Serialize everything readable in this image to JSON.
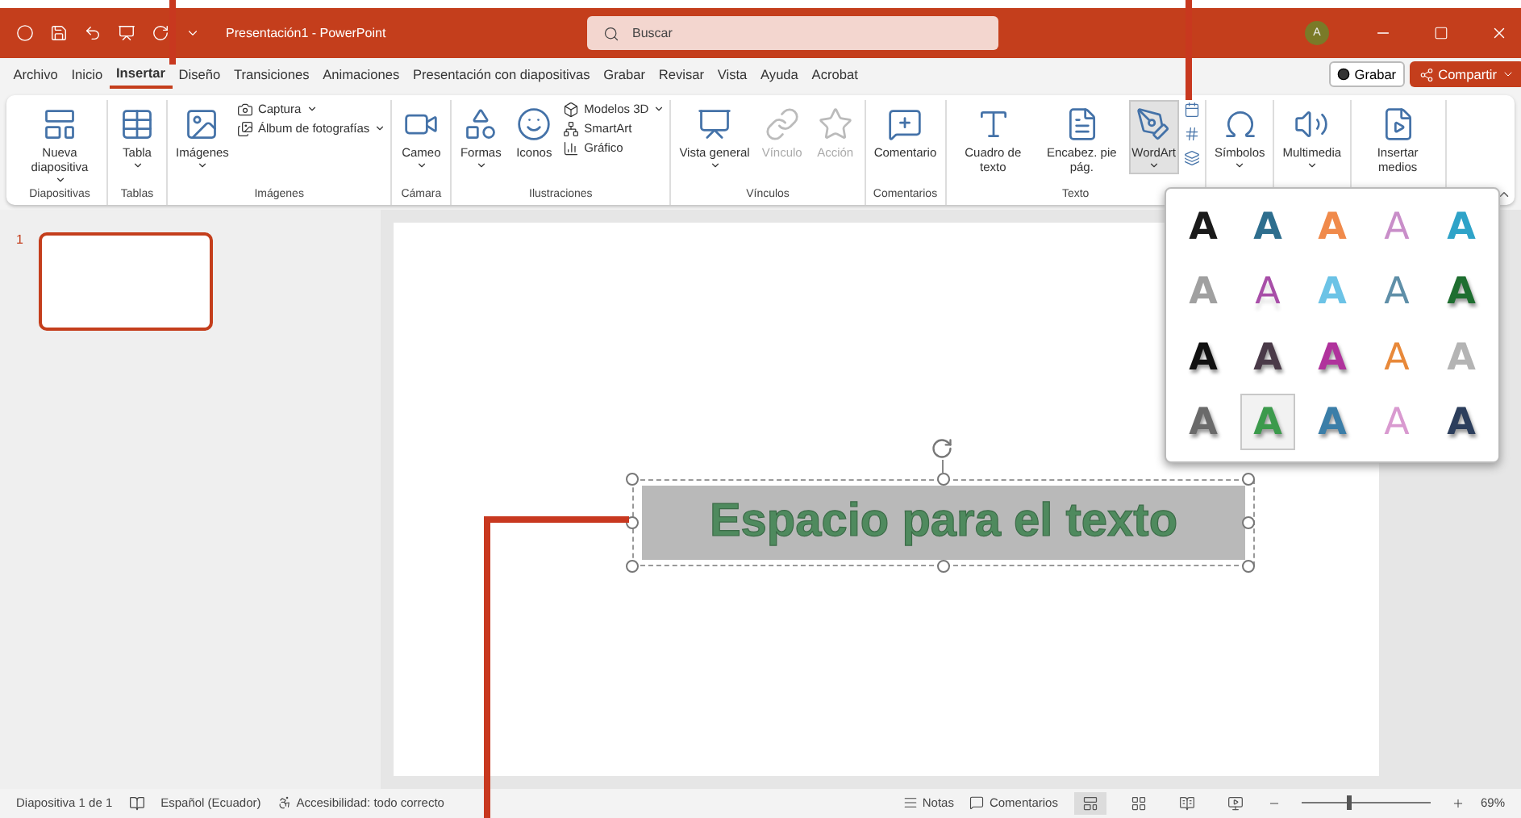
{
  "title_bar": {
    "title": "Presentación1 - PowerPoint",
    "search": {
      "placeholder": "Buscar"
    },
    "avatar": "A"
  },
  "tabs": [
    {
      "label": "Archivo",
      "selected": false
    },
    {
      "label": "Inicio",
      "selected": false
    },
    {
      "label": "Insertar",
      "selected": true
    },
    {
      "label": "Diseño",
      "selected": false
    },
    {
      "label": "Transiciones",
      "selected": false
    },
    {
      "label": "Animaciones",
      "selected": false
    },
    {
      "label": "Presentación con diapositivas",
      "selected": false
    },
    {
      "label": "Grabar",
      "selected": false
    },
    {
      "label": "Revisar",
      "selected": false
    },
    {
      "label": "Vista",
      "selected": false
    },
    {
      "label": "Ayuda",
      "selected": false
    },
    {
      "label": "Acrobat",
      "selected": false
    }
  ],
  "record_button": "Grabar",
  "share_button": "Compartir",
  "ribbon": [
    {
      "label": "Diapositivas",
      "items": [
        {
          "kind": "large",
          "label": "Nueva diapositiva",
          "dropdown": true
        }
      ]
    },
    {
      "label": "Tablas",
      "items": [
        {
          "kind": "large",
          "label": "Tabla",
          "dropdown": true
        }
      ]
    },
    {
      "label": "Imágenes",
      "items": [
        {
          "kind": "large",
          "label": "Imágenes",
          "dropdown": true
        },
        {
          "kind": "stack",
          "items": [
            {
              "label": "Captura",
              "dropdown": true
            },
            {
              "label": "Álbum de fotografías",
              "dropdown": true
            }
          ]
        }
      ]
    },
    {
      "label": "Cámara",
      "items": [
        {
          "kind": "large",
          "label": "Cameo",
          "dropdown": true
        }
      ]
    },
    {
      "label": "Ilustraciones",
      "items": [
        {
          "kind": "large",
          "label": "Formas",
          "dropdown": true
        },
        {
          "kind": "large",
          "label": "Iconos",
          "dropdown": false
        },
        {
          "kind": "stack",
          "items": [
            {
              "label": "Modelos 3D",
              "dropdown": true
            },
            {
              "label": "SmartArt",
              "dropdown": false
            },
            {
              "label": "Gráfico",
              "dropdown": false
            }
          ]
        }
      ]
    },
    {
      "label": "Vínculos",
      "items": [
        {
          "kind": "large",
          "label": "Vista general",
          "dropdown": true
        },
        {
          "kind": "large",
          "label": "Vínculo",
          "dropdown": false,
          "disabled": true
        },
        {
          "kind": "large",
          "label": "Acción",
          "dropdown": false,
          "disabled": true
        }
      ]
    },
    {
      "label": "Comentarios",
      "items": [
        {
          "kind": "large",
          "label": "Comentario",
          "dropdown": false
        }
      ]
    },
    {
      "label": "Texto",
      "items": [
        {
          "kind": "large",
          "label": "Cuadro de texto",
          "dropdown": false
        },
        {
          "kind": "large",
          "label": "Encabez. pie pág.",
          "dropdown": false
        },
        {
          "kind": "large",
          "label": "WordArt",
          "dropdown": true,
          "selected": true
        },
        {
          "kind": "icons"
        }
      ]
    },
    {
      "items": [
        {
          "kind": "large",
          "label": "Símbolos",
          "dropdown": true
        }
      ]
    },
    {
      "items": [
        {
          "kind": "large",
          "label": "Multimedia",
          "dropdown": true
        }
      ]
    },
    {
      "items": [
        {
          "kind": "large",
          "label": "Insertar medios",
          "dropdown": false
        }
      ]
    }
  ],
  "thumbnails": [
    {
      "number": "1",
      "selected": true
    }
  ],
  "slide": {
    "text": "Espacio para el texto"
  },
  "wordart_gallery": [
    {
      "letter": "A",
      "kind": "solid",
      "color": "#1a1a1a",
      "selected": false
    },
    {
      "letter": "A",
      "kind": "solid",
      "color": "#2e6e8e",
      "selected": false
    },
    {
      "letter": "A",
      "kind": "glow",
      "color": "#f08a4b",
      "selected": false
    },
    {
      "letter": "A",
      "kind": "outline",
      "color": "#c98ec9",
      "selected": false
    },
    {
      "letter": "A",
      "kind": "solid",
      "color": "#2fa3c8",
      "selected": false
    },
    {
      "letter": "A",
      "kind": "solid",
      "color": "#a0a0a0",
      "selected": false
    },
    {
      "letter": "A",
      "kind": "reflect",
      "color": "#a84ea8",
      "selected": false
    },
    {
      "letter": "A",
      "kind": "glow",
      "color": "#6cc3e6",
      "selected": false
    },
    {
      "letter": "A",
      "kind": "outline",
      "color": "#5f8fa8",
      "selected": false
    },
    {
      "letter": "A",
      "kind": "shadow",
      "color": "#1e6e30",
      "selected": false
    },
    {
      "letter": "A",
      "kind": "shadow",
      "color": "#111111",
      "selected": false
    },
    {
      "letter": "A",
      "kind": "shadow",
      "color": "#4a3a48",
      "selected": false
    },
    {
      "letter": "A",
      "kind": "shadow",
      "color": "#b0329c",
      "selected": false
    },
    {
      "letter": "A",
      "kind": "outline",
      "color": "#e8893a",
      "selected": false
    },
    {
      "letter": "A",
      "kind": "glow",
      "color": "#b4b4b4",
      "selected": false
    },
    {
      "letter": "A",
      "kind": "shadow",
      "color": "#6a6a6a",
      "selected": false
    },
    {
      "letter": "A",
      "kind": "shadow",
      "color": "#3c9a4c",
      "selected": true
    },
    {
      "letter": "A",
      "kind": "shadow",
      "color": "#3b7ea8",
      "selected": false
    },
    {
      "letter": "A",
      "kind": "outline",
      "color": "#d99ad0",
      "selected": false
    },
    {
      "letter": "A",
      "kind": "shadow",
      "color": "#2c3e5c",
      "selected": false
    }
  ],
  "status_bar": {
    "slide_count": "Diapositiva 1 de 1",
    "language": "Español (Ecuador)",
    "accessibility": "Accesibilidad: todo correcto",
    "notes": "Notas",
    "comments": "Comentarios",
    "views": [
      {
        "selected": true
      },
      {
        "selected": false
      },
      {
        "selected": false
      },
      {
        "selected": false
      }
    ],
    "zoom": {
      "level": 0.35,
      "reading": "69%"
    }
  }
}
